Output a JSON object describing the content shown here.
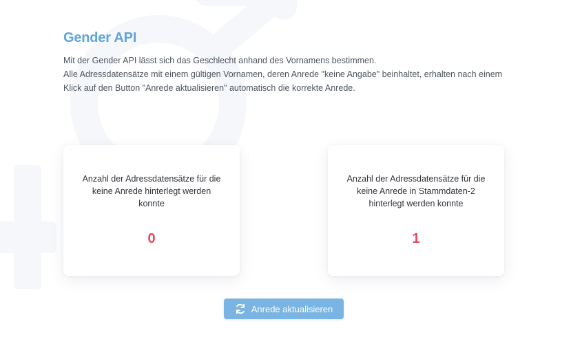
{
  "page": {
    "title": "Gender API",
    "description_line_1": "Mit der Gender API lässt sich das Geschlecht anhand des Vornamens bestimmen.",
    "description_line_2": "Alle Adressdatensätze mit einem gültigen Vornamen, deren Anrede \"keine Angabe\" beinhaltet, erhalten nach einem Klick auf den Button \"Anrede aktualisieren\" automatisch die korrekte Anrede."
  },
  "cards": [
    {
      "label": "Anzahl der Adressdatensätze für die keine Anrede hinterlegt werden konnte",
      "value": "0"
    },
    {
      "label": "Anzahl der Adressdatensätze für die keine Anrede in Stammdaten-2 hinterlegt werden konnte",
      "value": "1"
    }
  ],
  "actions": {
    "update_label": "Anrede aktualisieren",
    "update_icon": "refresh-icon"
  },
  "colors": {
    "title": "#5fa4dc",
    "value": "#e5485f",
    "button": "#7ab4e2",
    "background_symbol": "#f5f7fa"
  }
}
